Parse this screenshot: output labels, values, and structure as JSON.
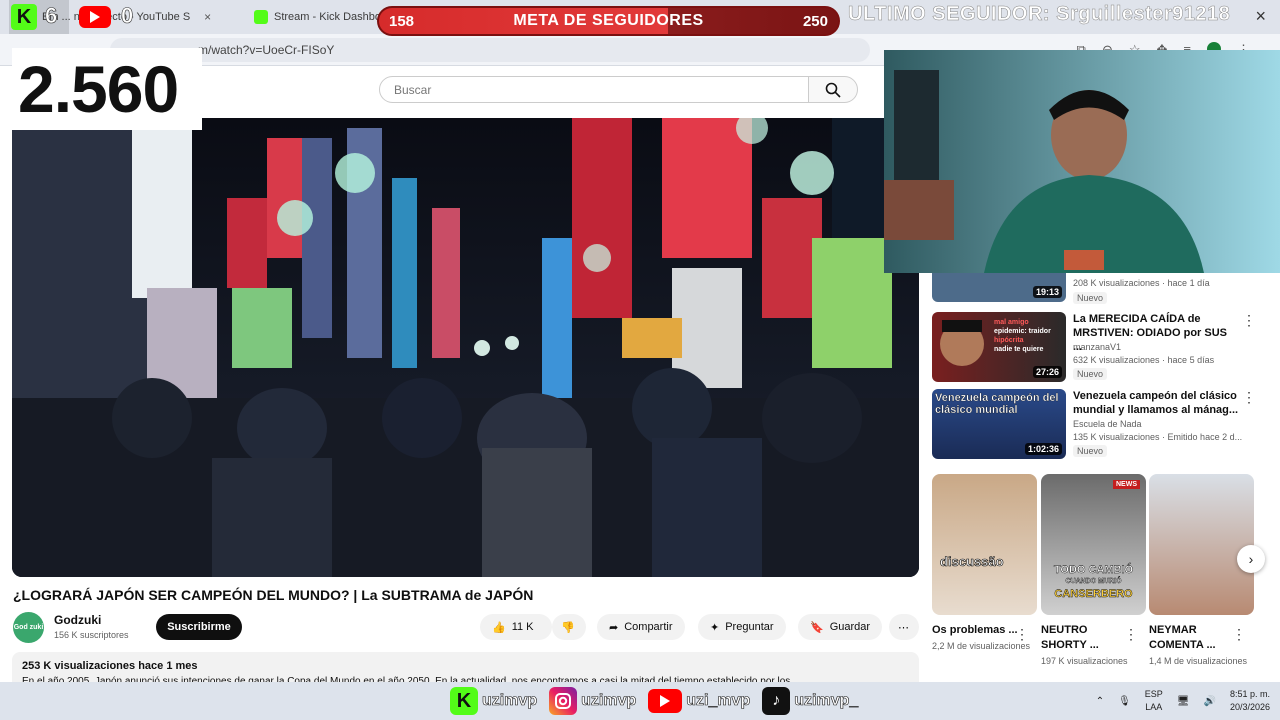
{
  "browser": {
    "tabs": [
      {
        "label": "Em  ... n cl ... ecto - YouTube S",
        "close": "×"
      },
      {
        "label": "Stream - Kick Dashbo",
        "close": "×"
      }
    ],
    "url": "m/watch?v=UoeCr-FISoY",
    "window_close": "×"
  },
  "stream_overlay": {
    "kick_viewers": "6",
    "youtube_viewers": "0",
    "follower_count": "2.560",
    "goal": {
      "current": "158",
      "title": "META DE SEGUIDORES",
      "target": "250",
      "progress": 0.632
    },
    "last_follower": "ULTIMO SEGUIDOR: Srguillester91218",
    "socials": [
      {
        "platform": "kick",
        "handle": "uzimvp"
      },
      {
        "platform": "instagram",
        "handle": "uzimvp"
      },
      {
        "platform": "youtube",
        "handle": "uzi_mvp"
      },
      {
        "platform": "tiktok",
        "handle": "uzimvp_"
      }
    ]
  },
  "youtube": {
    "search_placeholder": "Buscar",
    "video_title": "¿LOGRARÁ JAPÓN SER CAMPEÓN DEL MUNDO? | La SUBTRAMA de JAPÓN",
    "channel": {
      "name": "Godzuki",
      "subscribers": "156 K suscriptores",
      "avatar_text": "God zuki"
    },
    "subscribe_label": "Suscribirme",
    "actions": {
      "likes": "11 K",
      "share": "Compartir",
      "ask": "Preguntar",
      "save": "Guardar"
    },
    "description": {
      "views": "253 K visualizaciones",
      "age": "hace 1 mes",
      "text": "En el año 2005, Japón anunció sus intenciones de ganar la Copa del Mundo en el año 2050. En la actualidad, nos encontramos a casi la mitad del tiempo establecido por los"
    },
    "recommendations": [
      {
        "title": "",
        "channel": "",
        "stats": "208 K visualizaciones · hace 1 día",
        "duration": "19:13",
        "badge": "Nuevo"
      },
      {
        "title": "La MERECIDA CAÍDA de MRSTIVEN: ODIADO por SUS ...",
        "channel": "manzanaV1",
        "stats": "632 K visualizaciones · hace 5 días",
        "duration": "27:26",
        "badge": "Nuevo",
        "thumb_lines": [
          "mal amigo",
          "epidemic: traidor",
          "hipócrita",
          "nadie te quiere"
        ]
      },
      {
        "title": "Venezuela campeón del clásico mundial y llamamos al mánag...",
        "channel": "Escuela de Nada",
        "stats": "135 K visualizaciones · Emitido hace 2 d...",
        "duration": "1:02:36",
        "badge": "Nuevo",
        "thumb_text": "Venezuela campeón del clásico mundial"
      }
    ],
    "shorts": [
      {
        "title": "Os problemas ...",
        "views": "2,2 M de visualizaciones",
        "thumb_text": "discussão"
      },
      {
        "title": "NEUTRO SHORTY ...",
        "views": "197 K visualizaciones",
        "thumb_text_1": "TODO CAMBIÓ",
        "thumb_text_2": "CUANDO MURIÓ",
        "thumb_text_3": "CANSERBERO",
        "thumb_badge": "NEWS"
      },
      {
        "title": "NEYMAR COMENTA ...",
        "views": "1,4 M de visualizaciones"
      }
    ]
  },
  "taskbar": {
    "lang": "ESP",
    "region": "LAA",
    "time": "8:51 p. m.",
    "date": "20/3/2026"
  },
  "colors": {
    "kick_green": "#53fc18",
    "youtube_red": "#ff0000",
    "goal_red": "#d62b2b"
  }
}
